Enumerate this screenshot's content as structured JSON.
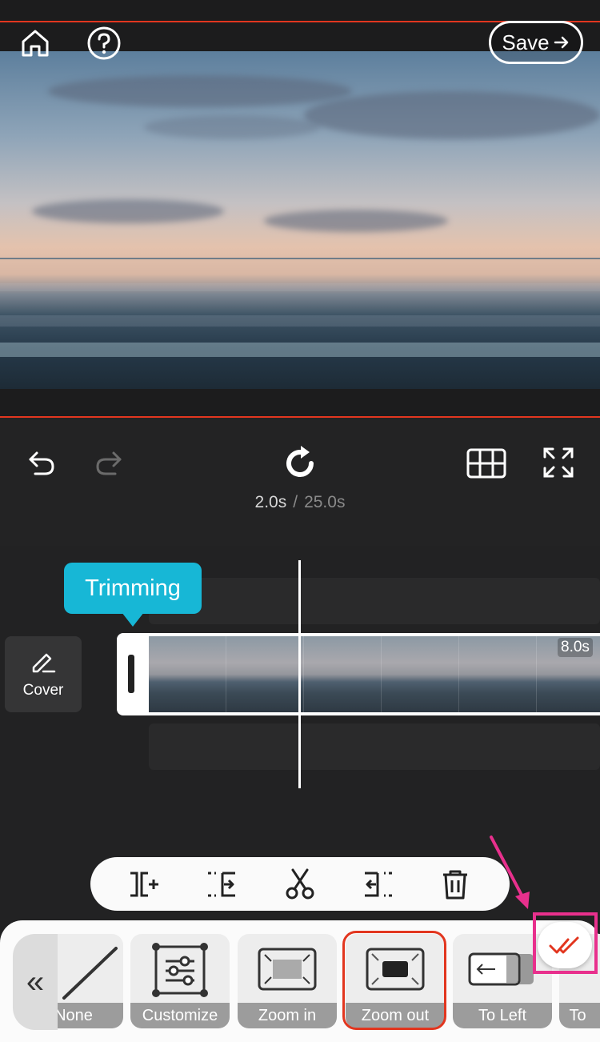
{
  "header": {
    "save_label": "Save"
  },
  "playback": {
    "current_time": "2.0s",
    "separator": "/",
    "total_time": "25.0s"
  },
  "timeline": {
    "tooltip": "Trimming",
    "cover_label": "Cover",
    "clip_duration": "8.0s"
  },
  "effects": [
    {
      "label": "None"
    },
    {
      "label": "Customize"
    },
    {
      "label": "Zoom in"
    },
    {
      "label": "Zoom out"
    },
    {
      "label": "To Left"
    },
    {
      "label": "To"
    }
  ],
  "selected_effect": "Zoom out",
  "colors": {
    "accent_red": "#e2361f",
    "tooltip_cyan": "#17b7d6",
    "annotation_pink": "#e8308d"
  }
}
